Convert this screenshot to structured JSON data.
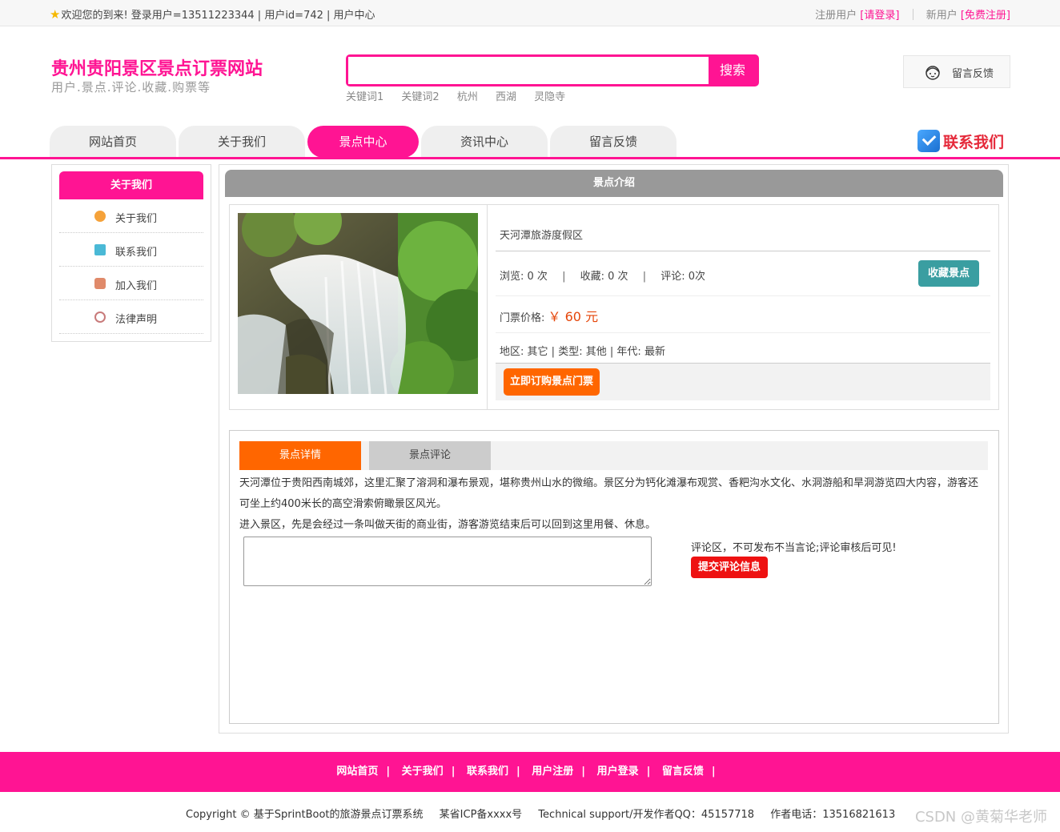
{
  "topbar": {
    "welcome": "欢迎您的到来!  登录用户=13511223344 | 用户id=742 | 用户中心",
    "register_prefix": "注册用户",
    "login_link": "[请登录]",
    "new_user_prefix": "新用户",
    "free_register_link": "[免费注册]"
  },
  "header": {
    "site_title": "贵州贵阳景区景点订票网站",
    "site_subtitle": "用户.景点.评论.收藏.购票等",
    "search_placeholder": "",
    "search_button": "搜索",
    "keywords": [
      "关键词1",
      "关键词2",
      "杭州",
      "西湖",
      "灵隐寺"
    ],
    "feedback_label": "留言反馈"
  },
  "nav": {
    "tabs": [
      "网站首页",
      "关于我们",
      "景点中心",
      "资讯中心",
      "留言反馈"
    ],
    "active_index": 2,
    "contact_label": "联系我们"
  },
  "sidebar": {
    "title": "关于我们",
    "items": [
      {
        "label": "关于我们",
        "icon": "star-badge-icon",
        "color": "#f5a23a"
      },
      {
        "label": "联系我们",
        "icon": "clipboard-icon",
        "color": "#4ab9d6"
      },
      {
        "label": "加入我们",
        "icon": "lock-icon",
        "color": "#e08a6a"
      },
      {
        "label": "法律声明",
        "icon": "power-icon",
        "color": "#c87a7a"
      }
    ]
  },
  "main": {
    "section_title": "景点介绍",
    "spot": {
      "name": "天河潭旅游度假区",
      "views_label": "浏览:",
      "views": "0 次",
      "favorites_label": "收藏:",
      "favorites": "0 次",
      "comments_label": "评论:",
      "comments": "0次",
      "favorite_button": "收藏景点",
      "price_label": "门票价格:",
      "price": "￥ 60 元",
      "region_label": "地区:",
      "region": "其它",
      "type_label": "类型:",
      "type": "其他",
      "era_label": "年代:",
      "era": "最新",
      "buy_button": "立即订购景点门票"
    },
    "detail": {
      "tab_detail": "景点详情",
      "tab_comments": "景点评论",
      "paragraph1": "天河潭位于贵阳西南城郊，这里汇聚了溶洞和瀑布景观，堪称贵州山水的微缩。景区分为钙化滩瀑布观赏、香粑沟水文化、水洞游船和旱洞游览四大内容，游客还可坐上约400米长的高空滑索俯瞰景区风光。",
      "paragraph2": "进入景区，先是会经过一条叫做天街的商业街，游客游览结束后可以回到这里用餐、休息。",
      "comment_note": "评论区，不可发布不当言论;评论审核后可见!",
      "submit_button": "提交评论信息"
    }
  },
  "footer": {
    "links": [
      "网站首页",
      "关于我们",
      "联系我们",
      "用户注册",
      "用户登录",
      "留言反馈"
    ],
    "copyright": "Copyright © 基于SprintBoot的旅游景点订票系统",
    "icp": "某省ICP备xxxx号",
    "support": "Technical support/开发作者QQ：45157718",
    "phone": "作者电话：13516821613"
  },
  "watermark": "CSDN @黄菊华老师",
  "colors": {
    "brand_pink": "#ff1493",
    "orange": "#ff6600",
    "teal": "#3a9ea1",
    "red": "#ee1111"
  }
}
